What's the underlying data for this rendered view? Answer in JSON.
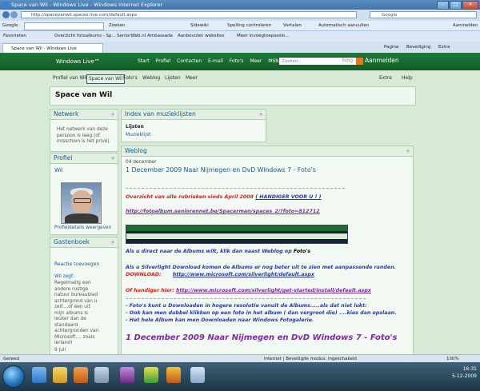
{
  "window": {
    "title": "Space van Wil - Windows Live - Windows Internet Explorer"
  },
  "address": {
    "url": "http://spacevanwil.spaces.live.com/default.aspx",
    "search_placeholder": "Google"
  },
  "google_toolbar": {
    "label": "Google",
    "zoeken": "Zoeken",
    "sidewiki": "Sidewiki",
    "spelling": "Spelling controleren",
    "vertalen": "Vertalen",
    "aanvullen": "Automatisch aanvullen",
    "aanmelden": "Aanmelden"
  },
  "favorites_bar": {
    "favorieten": "Favorieten",
    "items": [
      "Overzicht fotoalbums - Sp...",
      "SeniorWeb.nl  Ambassade",
      "Aanbevolen websites",
      "Meer invoegtoepassin..."
    ]
  },
  "tab": {
    "title": "Space van Wil - Windows Live",
    "pagina": "Pagina",
    "beveiliging": "Beveiliging",
    "extra": "Extra"
  },
  "wl": {
    "logo": "Windows Live™",
    "nav": [
      "Start",
      "Profiel",
      "Contacten",
      "E-mail",
      "Foto's",
      "Meer",
      "MSN"
    ],
    "search_placeholder": "Zoeken...",
    "bing": "bing",
    "signin": "Aanmelden"
  },
  "menu": {
    "items": [
      "Profiel van Wil",
      "Space van Wil",
      "Foto's",
      "Weblog",
      "Lijsten",
      "Meer"
    ],
    "extra": "Extra",
    "help": "Help"
  },
  "space_title": "Space van Wil",
  "netwerk": {
    "title": "Netwerk",
    "text": "Het netwerk van deze persoon is leeg (of misschien is het privé)."
  },
  "profiel": {
    "title": "Profiel",
    "name": "Wil",
    "link": "Profieldetails weergeven"
  },
  "gastenboek": {
    "title": "Gastenboek",
    "action": "Reactie toevoegen",
    "author": "Wil zegt:",
    "text": "Regelmatig een andere rustige natuur bureaublad achtergrond van u zelf....of een uit mijn albums is leuker dan de standaard achtergronden van Microsoft.... zoals lerland!",
    "date": "9 Juli"
  },
  "index": {
    "title": "Index van muzieklijsten",
    "heading": "Lijsten",
    "item": "Muzieklijst"
  },
  "weblog": {
    "title": "Weblog",
    "date": "04 december",
    "post_title": "1 December 2009 Naar Nijmegen en DvD Windows 7 - Foto's",
    "l1": "Overzicht van alle rubrieken sinds April 2008",
    "l1b": "( HANDIGER VOOR U ! )",
    "l2": "http://fotoalbum.seniorennet.be/Spacerman/spaces_2/?foto=812712",
    "l3a": "Als u direct naar de Albums wilt, klik dan naast Weblog op ",
    "l3b": "Foto's",
    "l4": "Als u Silverlight Download komen de Albums er nog beter uit te zien met aanpassende randen.",
    "l5a": "DOWNLOAD:",
    "l5b": "http://www.microsoft.com/silverlight/default.aspx",
    "l6a": "Of handiger hier:",
    "l6b": "http://www.microsoft.com/silverlight/get-started/install/default.aspx",
    "l7": "- Foto's kunt u Downloaden in hogere resolutie vanuit de Albums.....als dat niet lukt:",
    "l8": "- Ook kan men dubbel klikken op een foto in het album ( dan vergroot die) ....kies dan opslaan.",
    "l9": "- Het hele Album kan men Downloaden naar Windows Fotogalerie.",
    "big": "1 December 2009 Naar Nijmegen en DvD Windows 7 - Foto's"
  },
  "status": {
    "left": "Gereed",
    "zone": "Internet | Beveiligde modus: ingeschakeld",
    "zoom": "100%"
  },
  "clock": {
    "time": "16:31",
    "date": "5-12-2009"
  }
}
